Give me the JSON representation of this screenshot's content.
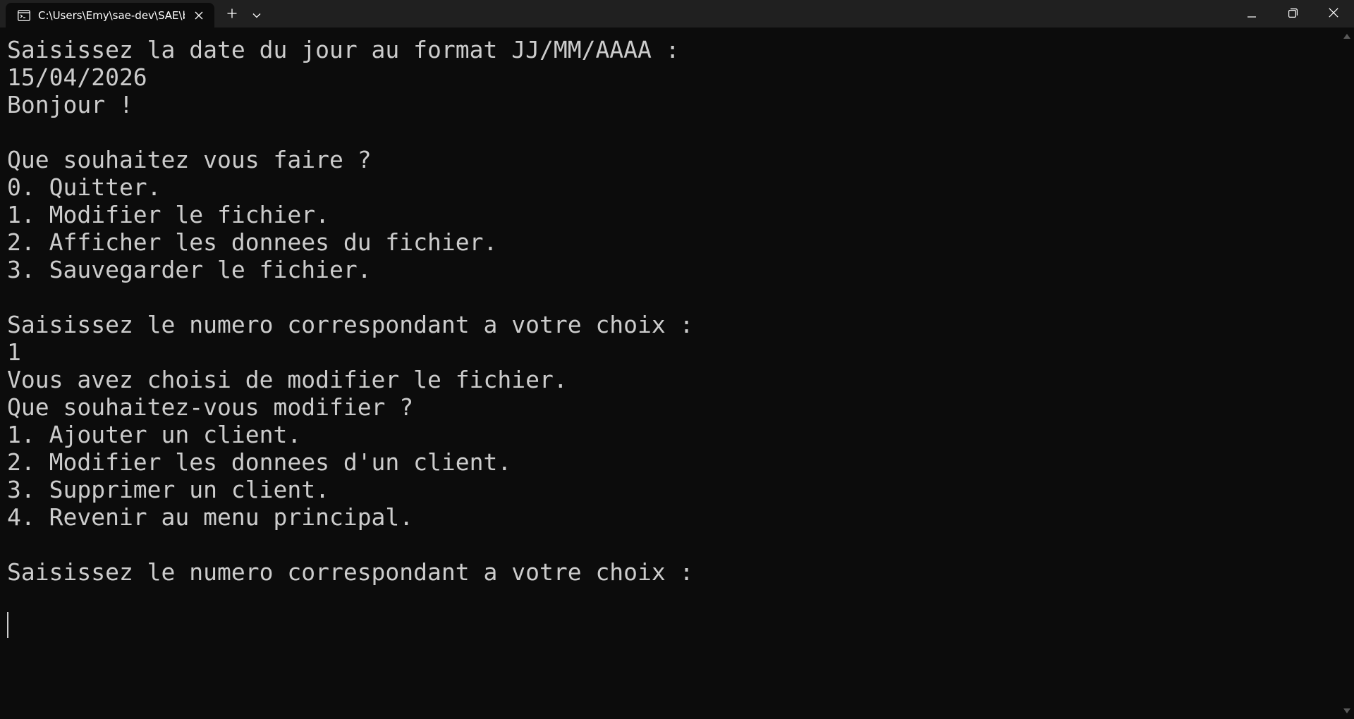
{
  "window": {
    "tab_title": "C:\\Users\\Emy\\sae-dev\\SAE\\bi",
    "tab_icon": "terminal-icon",
    "controls": [
      "minimize-icon",
      "restore-icon",
      "close-icon"
    ]
  },
  "terminal": {
    "lines": [
      "Saisissez la date du jour au format JJ/MM/AAAA :",
      "15/04/2026",
      "Bonjour !",
      "",
      "Que souhaitez vous faire ?",
      "0. Quitter.",
      "1. Modifier le fichier.",
      "2. Afficher les donnees du fichier.",
      "3. Sauvegarder le fichier.",
      "",
      "Saisissez le numero correspondant a votre choix :",
      "1",
      "Vous avez choisi de modifier le fichier.",
      "Que souhaitez-vous modifier ?",
      "1. Ajouter un client.",
      "2. Modifier les donnees d'un client.",
      "3. Supprimer un client.",
      "4. Revenir au menu principal.",
      "",
      "Saisissez le numero correspondant a votre choix :"
    ]
  },
  "colors": {
    "background": "#0c0c0c",
    "titlebar": "#202020",
    "text": "#cccccc"
  }
}
